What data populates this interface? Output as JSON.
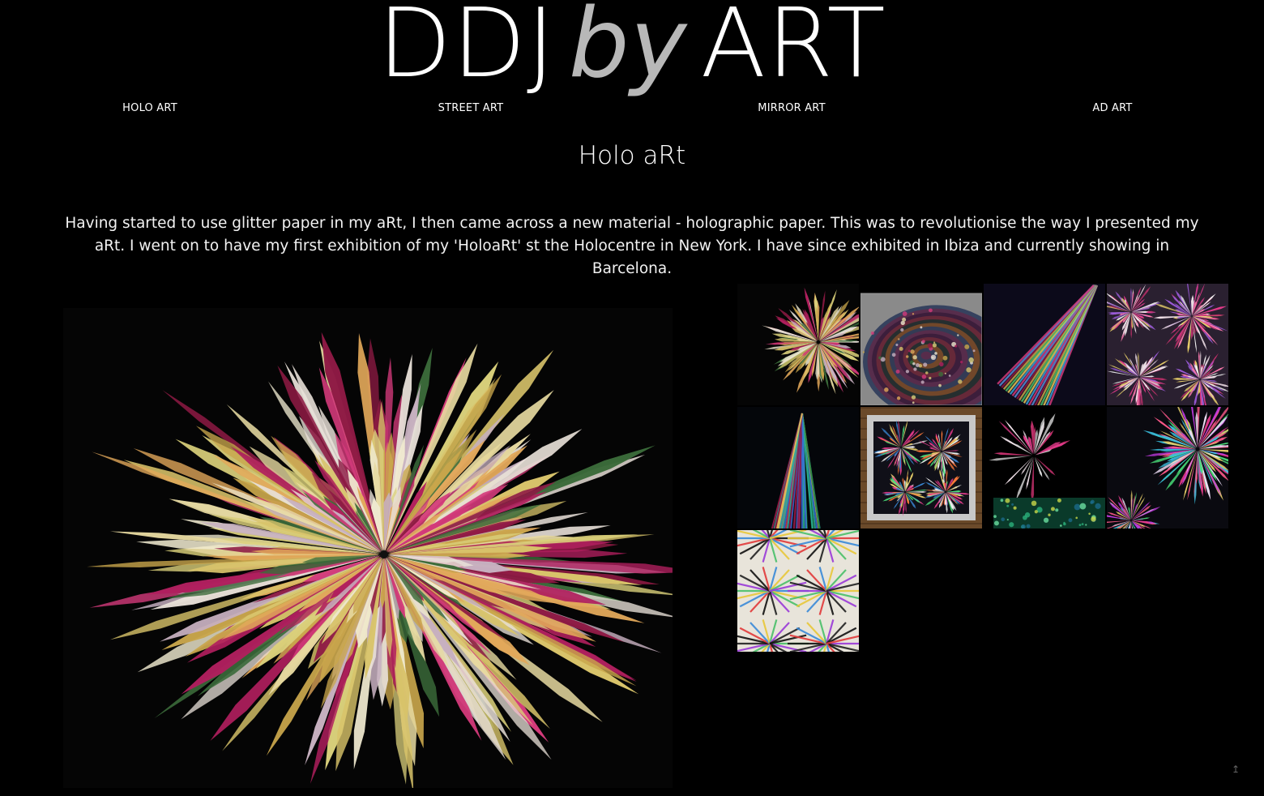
{
  "site": {
    "logo_part1": "DDJ",
    "logo_part2": "by",
    "logo_part3": "ART"
  },
  "nav": {
    "items": [
      {
        "label": "HOLO ART"
      },
      {
        "label": "STREET ART"
      },
      {
        "label": "MIRROR ART"
      },
      {
        "label": "AD ART"
      }
    ]
  },
  "page": {
    "title": "Holo aRt",
    "intro": "Having started to use glitter paper in my aRt, I then came across a new material - holographic paper. This was to revolutionise the way I presented my aRt. I went on to have my first exhibition of my 'HoloaRt' st the Holocentre in New York. I have since exhibited in Ibiza and currently showing in Barcelona."
  },
  "gallery": {
    "main_image": "holographic-starburst-artwork",
    "thumbnails": [
      {
        "name": "thumb-starburst"
      },
      {
        "name": "thumb-spiral-tunnel"
      },
      {
        "name": "thumb-cone-rays"
      },
      {
        "name": "thumb-fireworks"
      },
      {
        "name": "thumb-tower"
      },
      {
        "name": "thumb-framed-fireworks"
      },
      {
        "name": "thumb-star-collage"
      },
      {
        "name": "thumb-purple-burst"
      },
      {
        "name": "thumb-kaleidoscope"
      }
    ]
  },
  "colors": {
    "background": "#000000",
    "text": "#ffffff",
    "logo_accent": "#b8b8b8"
  }
}
